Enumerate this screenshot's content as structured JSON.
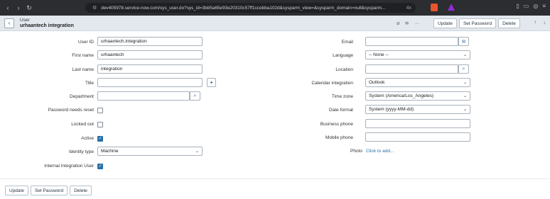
{
  "browser": {
    "url": "dev405978.service-now.com/sys_user.do?sys_id=3bb5a65e93e20310c57ff1ccebba102d&sysparm_view=&sysparm_domain=null&sysparm...",
    "url_suffix": "4x"
  },
  "header": {
    "record_type": "User",
    "record_name": "urhaantech integration",
    "buttons": {
      "update": "Update",
      "set_password": "Set Password",
      "delete": "Delete"
    }
  },
  "left_fields": {
    "user_id": {
      "label": "User ID",
      "value": "urhaantech.integration"
    },
    "first_name": {
      "label": "First name",
      "value": "urhaantech"
    },
    "last_name": {
      "label": "Last name",
      "value": "integration"
    },
    "title": {
      "label": "Title",
      "value": ""
    },
    "department": {
      "label": "Department",
      "value": ""
    },
    "password_needs_reset": {
      "label": "Password needs reset",
      "checked": false
    },
    "locked_out": {
      "label": "Locked out",
      "checked": false
    },
    "active": {
      "label": "Active",
      "checked": true
    },
    "identity_type": {
      "label": "Identity type",
      "value": "Machine"
    },
    "internal_integration_user": {
      "label": "Internal Integration User",
      "checked": true
    }
  },
  "right_fields": {
    "email": {
      "label": "Email",
      "value": ""
    },
    "language": {
      "label": "Language",
      "value": "-- None --"
    },
    "location": {
      "label": "Location",
      "value": ""
    },
    "calendar_integration": {
      "label": "Calendar integration",
      "value": "Outlook"
    },
    "time_zone": {
      "label": "Time zone",
      "value": "System (America/Los_Angeles)"
    },
    "date_format": {
      "label": "Date format",
      "value": "System (yyyy-MM-dd)"
    },
    "business_phone": {
      "label": "Business phone",
      "value": ""
    },
    "mobile_phone": {
      "label": "Mobile phone",
      "value": ""
    },
    "photo": {
      "label": "Photo",
      "link": "Click to add..."
    }
  },
  "footer": {
    "buttons": {
      "update": "Update",
      "set_password": "Set Password",
      "delete": "Delete"
    }
  },
  "icons": {
    "checkmark": "✓",
    "colors": {
      "accent": "#2a6fa8",
      "header_bg": "#e3e8ee",
      "browser_bg": "#2b2d31"
    }
  }
}
